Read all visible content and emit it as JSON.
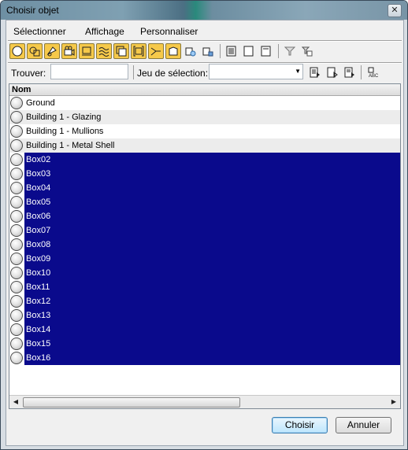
{
  "window": {
    "title": "Choisir objet",
    "close_glyph": "✕"
  },
  "menu": [
    {
      "label": "Sélectionner"
    },
    {
      "label": "Affichage"
    },
    {
      "label": "Personnaliser"
    }
  ],
  "toolbar": {
    "filter_icons": [
      "geometry-icon",
      "shapes-icon",
      "lights-icon",
      "cameras-icon",
      "helpers-icon",
      "spacewarps-icon",
      "groups-icon",
      "xrefs-icon",
      "bones-icon",
      "containers-icon",
      "frozen-icon",
      "hidden-icon"
    ],
    "view_icons": [
      "list-view-icon",
      "blank-view-icon",
      "detail-view-icon"
    ],
    "extra_icons": [
      "filter-icon",
      "filter-options-icon"
    ]
  },
  "find": {
    "label": "Trouver:",
    "value": ""
  },
  "selection_set": {
    "label": "Jeu de sélection:",
    "value": ""
  },
  "list": {
    "header": "Nom",
    "items": [
      {
        "name": "Ground",
        "selected": false
      },
      {
        "name": "Building 1 - Glazing",
        "selected": false
      },
      {
        "name": "Building 1 - Mullions",
        "selected": false
      },
      {
        "name": "Building 1 - Metal Shell",
        "selected": false
      },
      {
        "name": "Box02",
        "selected": true
      },
      {
        "name": "Box03",
        "selected": true
      },
      {
        "name": "Box04",
        "selected": true
      },
      {
        "name": "Box05",
        "selected": true
      },
      {
        "name": "Box06",
        "selected": true
      },
      {
        "name": "Box07",
        "selected": true
      },
      {
        "name": "Box08",
        "selected": true
      },
      {
        "name": "Box09",
        "selected": true
      },
      {
        "name": "Box10",
        "selected": true
      },
      {
        "name": "Box11",
        "selected": true
      },
      {
        "name": "Box12",
        "selected": true
      },
      {
        "name": "Box13",
        "selected": true
      },
      {
        "name": "Box14",
        "selected": true
      },
      {
        "name": "Box15",
        "selected": true
      },
      {
        "name": "Box16",
        "selected": true
      }
    ]
  },
  "buttons": {
    "ok": "Choisir",
    "cancel": "Annuler"
  },
  "colors": {
    "selection": "#0a0a8c",
    "toolbar_active": "#f6c94a"
  }
}
